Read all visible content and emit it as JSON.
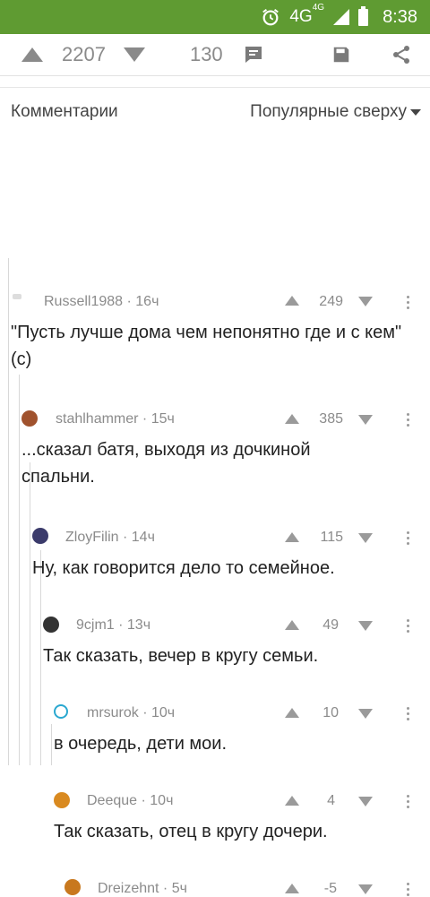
{
  "status": {
    "network": "4G",
    "network_sup": "4G",
    "time": "8:38"
  },
  "post": {
    "rating": "2207",
    "comments_count": "130"
  },
  "comments_header": {
    "title": "Комментарии",
    "sort_label": "Популярные сверху"
  },
  "comments": [
    {
      "author": "Russell1988",
      "time": "16ч",
      "score": "249",
      "text": "\"Пусть лучше дома чем непонятно где и с кем\"(с)"
    },
    {
      "author": "stahlhammer",
      "time": "15ч",
      "score": "385",
      "text": "...сказал батя, выходя из дочкиной спальни."
    },
    {
      "author": "ZloyFilin",
      "time": "14ч",
      "score": "115",
      "text": "Ну, как говорится дело то семейное."
    },
    {
      "author": "9cjm1",
      "time": "13ч",
      "score": "49",
      "text": "Так сказать, вечер в кругу семьи."
    },
    {
      "author": "mrsurok",
      "time": "10ч",
      "score": "10",
      "text": "в очередь, дети мои."
    },
    {
      "author": "Deeque",
      "time": "10ч",
      "score": "4",
      "text": "Так сказать, отец в кругу дочери."
    },
    {
      "author": "Dreizehnt",
      "time": "5ч",
      "score": "-5",
      "text": ""
    }
  ],
  "colors": {
    "statusbar": "#5f9b32",
    "meta": "#8b8b8b",
    "icons": "#8a8a8a"
  }
}
